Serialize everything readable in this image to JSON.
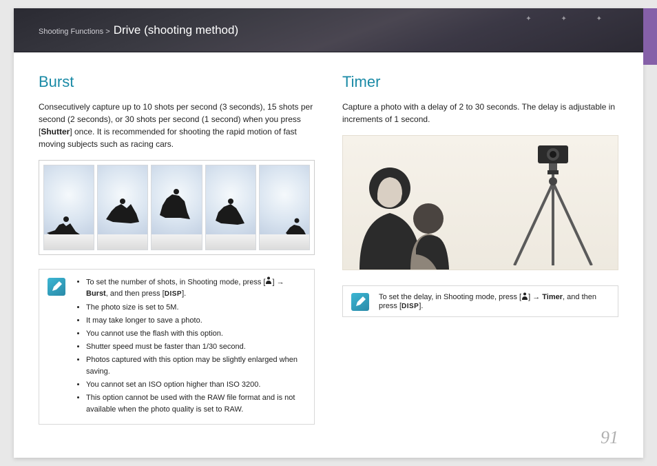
{
  "header": {
    "breadcrumb_prefix": "Shooting Functions > ",
    "title": "Drive (shooting method)"
  },
  "burst": {
    "heading": "Burst",
    "body_1": "Consecutively capture up to 10 shots per second (3 seconds), 15 shots per second (2 seconds), or 30 shots per second (1 second) when you press [",
    "body_bold": "Shutter",
    "body_2": "] once. It is recommended for shooting the rapid motion of fast moving subjects such as racing cars.",
    "notes": {
      "intro_a": "To set the number of shots, in Shooting mode, press [",
      "intro_arrow": "→",
      "intro_bold": "Burst",
      "intro_b": ", and then press [",
      "intro_disp": "DISP",
      "intro_end": "].",
      "items": [
        "The photo size is set to 5M.",
        "It may take longer to save a photo.",
        "You cannot use the flash with this option.",
        "Shutter speed must be faster than 1/30 second.",
        "Photos captured with this option may be slightly enlarged when saving.",
        "You cannot set an ISO option higher than ISO 3200.",
        "This option cannot be used with the RAW file format and is not available when the photo quality is set to RAW."
      ]
    }
  },
  "timer": {
    "heading": "Timer",
    "body": "Capture a photo with a delay of 2 to 30 seconds. The delay is adjustable in increments of 1 second.",
    "note_a": "To set the delay, in Shooting mode, press [",
    "note_arrow": "→",
    "note_bold": "Timer",
    "note_b": ", and then press [",
    "note_disp": "DISP",
    "note_end": "]."
  },
  "page_number": "91"
}
